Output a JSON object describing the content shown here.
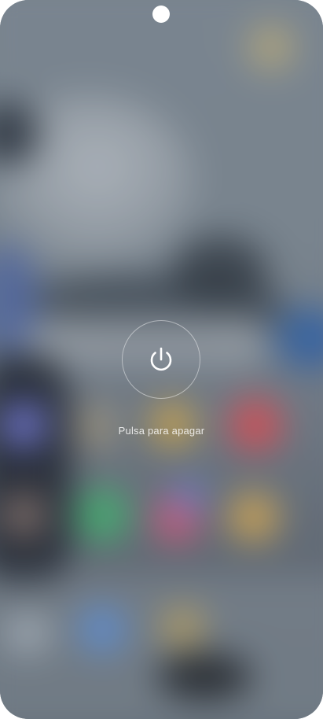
{
  "power_menu": {
    "hint_label": "Pulsa para apagar",
    "button_icon": "power-icon",
    "accent_color": "#ffffff"
  },
  "device": {
    "camera_cutout": "punch-hole-camera"
  }
}
